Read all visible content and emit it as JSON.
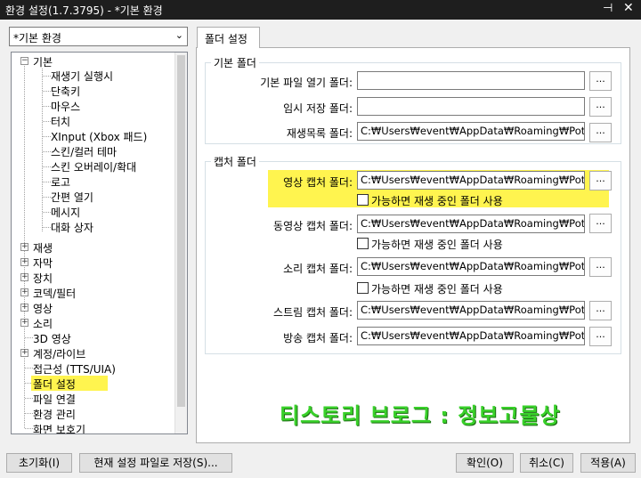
{
  "window": {
    "title": "환경 설정(1.7.3795) - *기본 환경",
    "pin_glyph": "⊣✕",
    "close_glyph": "✕"
  },
  "preset": {
    "value": "*기본 환경",
    "arrow": "⌄"
  },
  "tree": {
    "expanded_sign": "−",
    "collapsed_sign": "+",
    "basic": "기본",
    "basic_children": [
      "재생기 실행시",
      "단축키",
      "마우스",
      "터치",
      "XInput (Xbox 패드)",
      "스킨/컬러 테마",
      "스킨 오버레이/확대",
      "로고",
      "간편 열기",
      "메시지",
      "대화 상자"
    ],
    "top_items": [
      "재생",
      "자막",
      "장치",
      "코덱/필터",
      "영상",
      "소리",
      "3D 영상",
      "계정/라이브",
      "접근성 (TTS/UIA)",
      "폴더 설정",
      "파일 연결",
      "환경 관리",
      "화면 보호기"
    ],
    "selected": "폴더 설정"
  },
  "tab": {
    "label": "폴더 설정"
  },
  "basic_folders": {
    "title": "기본 폴더",
    "rows": [
      {
        "label": "기본 파일 열기 폴더:",
        "value": "",
        "button": "..."
      },
      {
        "label": "임시 저장 폴더:",
        "value": "",
        "button": "..."
      },
      {
        "label": "재생목록 폴더:",
        "value": "C:₩Users₩event₩AppData₩Roaming₩PotPlayer",
        "button": "..."
      }
    ]
  },
  "capture_folders": {
    "title": "캡처 폴더",
    "checkbox_label": "가능하면 재생 중인 폴더 사용",
    "rows": [
      {
        "label": "영상 캡처 폴더:",
        "value": "C:₩Users₩event₩AppData₩Roaming₩PotPlayer",
        "button": "..."
      },
      {
        "label": "동영상 캡처 폴더:",
        "value": "C:₩Users₩event₩AppData₩Roaming₩PotPlayer",
        "button": "..."
      },
      {
        "label": "소리 캡처 폴더:",
        "value": "C:₩Users₩event₩AppData₩Roaming₩PotPlayer",
        "button": "..."
      },
      {
        "label": "스트림 캡처 폴더:",
        "value": "C:₩Users₩event₩AppData₩Roaming₩PotPlayer",
        "button": "..."
      },
      {
        "label": "방송 캡처 폴더:",
        "value": "C:₩Users₩event₩AppData₩Roaming₩PotPlayer",
        "button": "..."
      }
    ],
    "checked": [
      false,
      false,
      false
    ]
  },
  "watermark": "티스토리 브로그 : 정보고물상",
  "buttons": {
    "reset": "초기화(I)",
    "save_to_file": "현재 설정 파일로 저장(S)...",
    "ok": "확인(O)",
    "cancel": "취소(C)",
    "apply": "적용(A)"
  },
  "colors": {
    "highlight": "#fff44f",
    "titlebar": "#1e1e1e",
    "watermark": "#39d12a"
  }
}
